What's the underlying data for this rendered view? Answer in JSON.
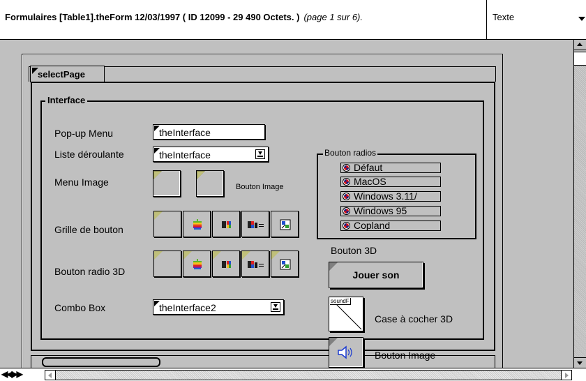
{
  "header": {
    "title": "Formulaires [Table1].theForm  12/03/1997 (  ID 12099 - 29 490 Octets. )",
    "page_info": "(page 1 sur 6).",
    "view_select": "Texte"
  },
  "form": {
    "tab_label": "selectPage",
    "group_label": "Interface",
    "popup": {
      "label": "Pop-up Menu",
      "value": "theInterface"
    },
    "list": {
      "label": "Liste déroulante",
      "value": "theInterface"
    },
    "menu_image": {
      "label": "Menu Image",
      "caption": "Bouton Image"
    },
    "button_grid": {
      "label": "Grille de bouton"
    },
    "radio3d": {
      "label": "Bouton radio 3D"
    },
    "combo": {
      "label": "Combo Box",
      "value": "theInterface2"
    },
    "radio_group": {
      "label": "Bouton radios",
      "options": [
        "Défaut",
        "MacOS",
        "Windows 3.11/",
        "Windows 95",
        "Copland"
      ]
    },
    "button3d": {
      "label": "Bouton 3D",
      "text": "Jouer son"
    },
    "checkbox3d": {
      "tag": "soundF",
      "label": "Case à cocher 3D"
    },
    "image_button": {
      "label": "Bouton Image"
    }
  },
  "bottom": {
    "nav_arrows": "◀◀▶▶"
  },
  "icons": {
    "grid_cells": [
      "blank-icon",
      "apple-icon",
      "color-icon",
      "color-text-icon",
      "picture-icon"
    ]
  }
}
